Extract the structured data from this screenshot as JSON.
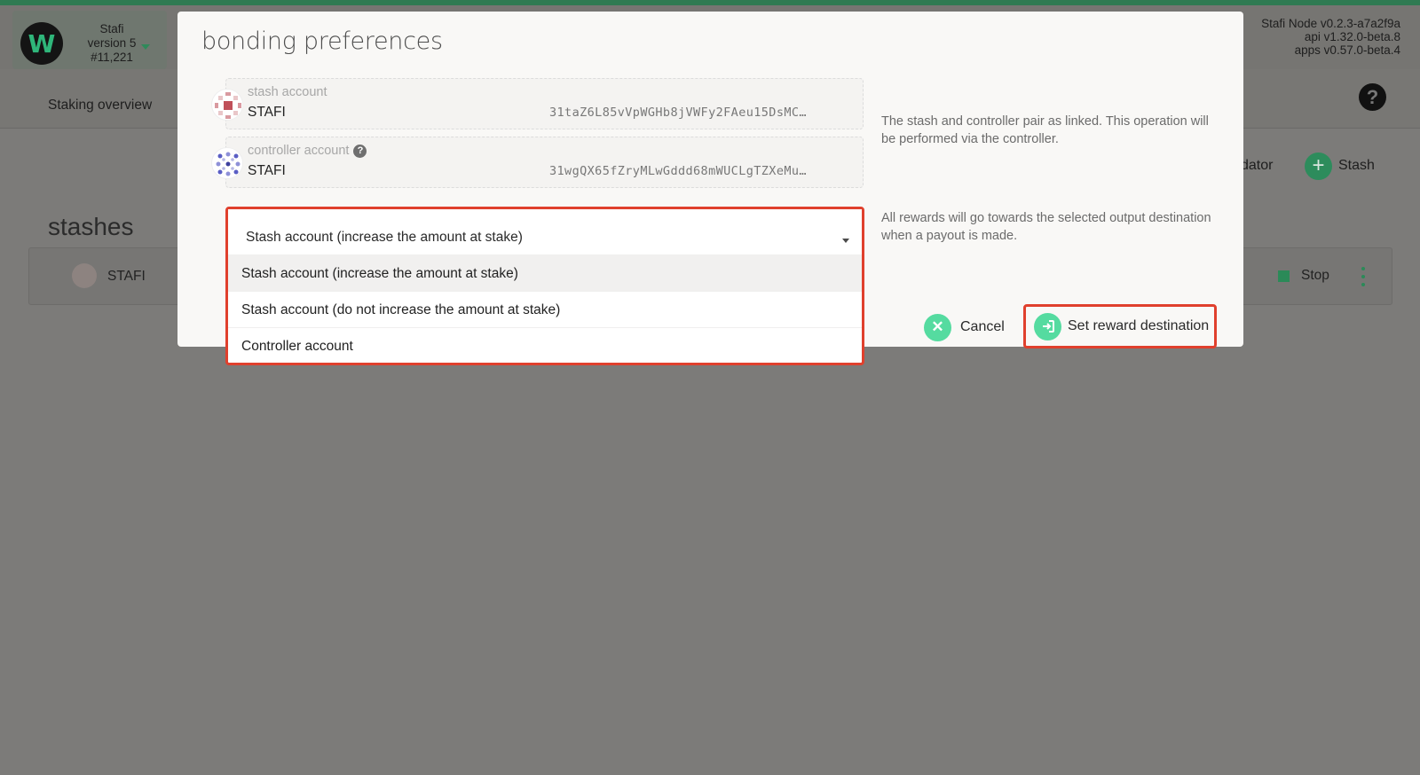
{
  "app": {
    "chain_name": "Stafi",
    "chain_version": "version 5",
    "block_number": "#11,221",
    "node_version": "Stafi Node v0.2.3-a7a2f9a",
    "api_version": "api v1.32.0-beta.8",
    "apps_version": "apps v0.57.0-beta.4",
    "logo_letter": "W"
  },
  "nav": {
    "tab_staking_overview": "Staking overview",
    "help_icon": "?"
  },
  "actions": {
    "validator_partial": "dator",
    "stash_label": "Stash",
    "plus_glyph": "+"
  },
  "stashes": {
    "title": "stashes",
    "rows": [
      {
        "name": "STAFI",
        "stop_label": "Stop"
      }
    ]
  },
  "modal": {
    "title": "bonding preferences",
    "stash_account": {
      "label": "stash account",
      "name": "STAFI",
      "address": "31taZ6L85vVpWGHb8jVWFy2FAeu15DsMC…"
    },
    "controller_account": {
      "label": "controller account",
      "name": "STAFI",
      "address": "31wgQX65fZryMLwGddd68mWUCLgTZXeMu…"
    },
    "pair_help": "The stash and controller pair as linked. This operation will be performed via the controller.",
    "reward_help": "All rewards will go towards the selected output destination when a payout is made.",
    "reward_destination": {
      "selected": "Stash account (increase the amount at stake)",
      "options": [
        "Stash account (increase the amount at stake)",
        "Stash account (do not increase the amount at stake)",
        "Controller account"
      ]
    },
    "cancel_label": "Cancel",
    "submit_label": "Set reward destination"
  },
  "colors": {
    "accent": "#55dba0",
    "highlight_border": "#e0402d",
    "brand_green": "#2f7a52"
  }
}
